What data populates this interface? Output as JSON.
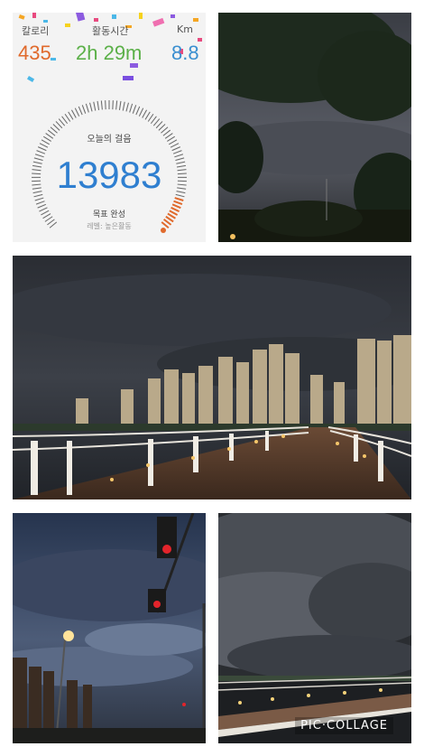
{
  "app": {
    "calories": {
      "label": "칼로리",
      "value": "435",
      "color": "#e06a2c"
    },
    "active_time": {
      "label": "활동시간",
      "value": "2h 29m",
      "color": "#5bb048"
    },
    "distance": {
      "label": "Km",
      "value": "8.8",
      "color": "#3a8fd0"
    },
    "dial": {
      "title": "오늘의 걸음",
      "steps": "13983",
      "goal_text": "목표 완성",
      "level_text": "레벨: 높은활동",
      "goal_progress": 1.0
    }
  },
  "watermark": "PIC·COLLAGE",
  "photos": [
    {
      "name": "tree-night-sky-photo"
    },
    {
      "name": "city-bridge-night-photo"
    },
    {
      "name": "traffic-light-dusk-photo"
    },
    {
      "name": "cloudy-sky-bridge-photo"
    }
  ]
}
